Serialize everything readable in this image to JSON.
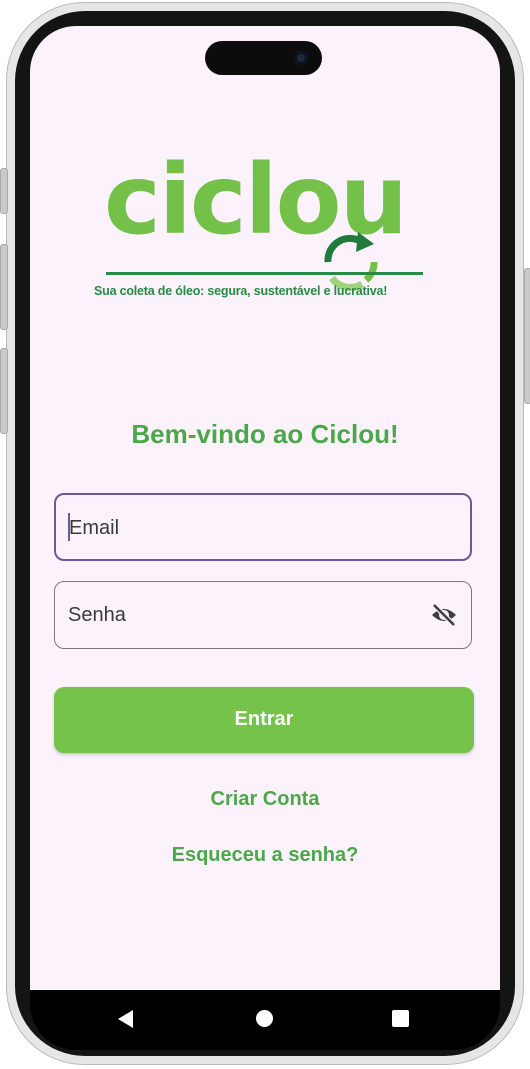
{
  "logo": {
    "brand": "ciclou",
    "tagline": "Sua coleta de óleo: segura, sustentável e lucrativa!"
  },
  "login": {
    "title": "Bem-vindo ao Ciclou!",
    "email_label": "Email",
    "password_label": "Senha",
    "submit_label": "Entrar",
    "create_account_label": "Criar Conta",
    "forgot_password_label": "Esqueceu a senha?"
  },
  "colors": {
    "brand_green": "#74c14a",
    "dark_green": "#2a8a43",
    "text_green": "#4aa84a",
    "focus_purple": "#6a5a9c",
    "screen_bg": "#fbf2fb"
  },
  "icons": {
    "password_toggle": "eye-off-icon",
    "nav_back": "back-triangle-icon",
    "nav_home": "home-circle-icon",
    "nav_recent": "recent-square-icon"
  }
}
